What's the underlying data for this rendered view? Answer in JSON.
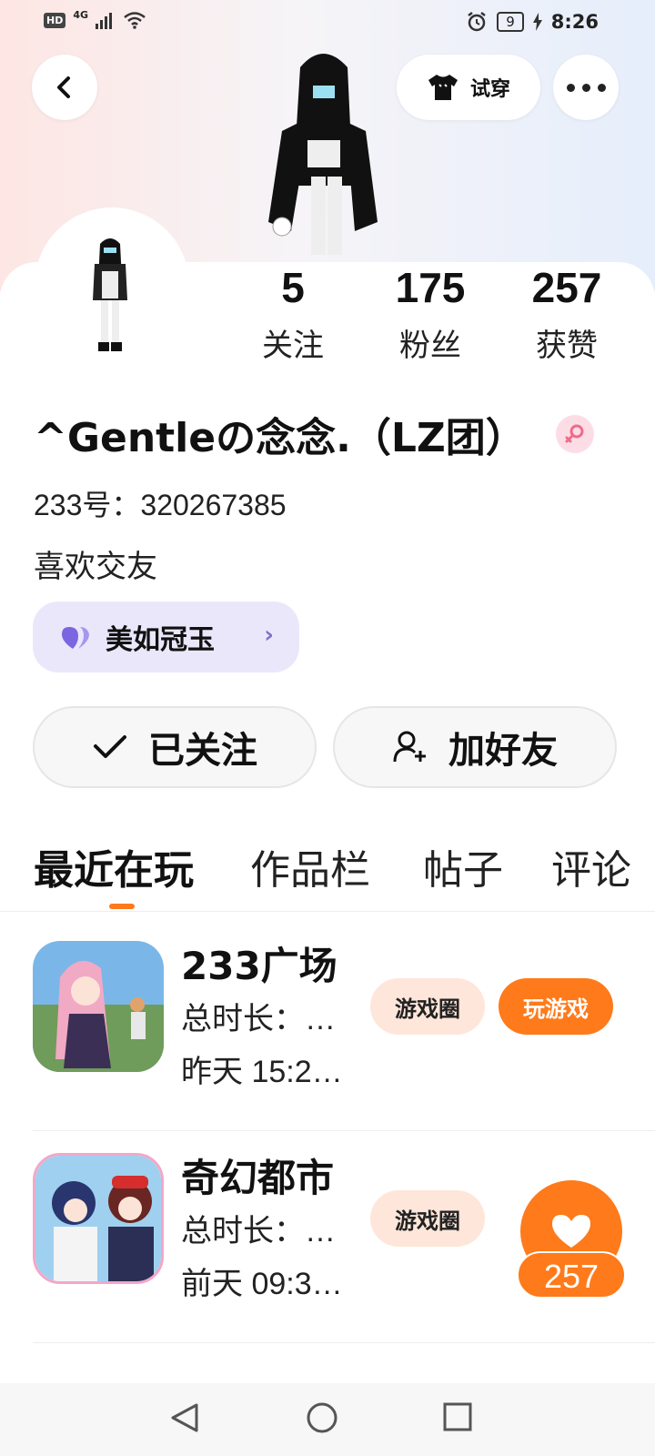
{
  "status_bar": {
    "hd_label": "HD",
    "network": "4G",
    "battery_level": "9",
    "time": "8:26"
  },
  "header": {
    "try_on_label": "试穿"
  },
  "stats": [
    {
      "value": "5",
      "label": "关注"
    },
    {
      "value": "175",
      "label": "粉丝"
    },
    {
      "value": "257",
      "label": "获赞"
    }
  ],
  "profile": {
    "name": "^Gentleの念念.（LZ团）",
    "account_id": "233号：320267385",
    "bio": "喜欢交友",
    "tag_label": "美如冠玉",
    "tag_chevron": "›"
  },
  "actions": {
    "follow_label": "已关注",
    "add_friend_label": "加好友"
  },
  "tabs": [
    "最近在玩",
    "作品栏",
    "帖子",
    "评论"
  ],
  "games": [
    {
      "title": "233广场",
      "duration": "总时长：…",
      "last_played": "昨天 15:2…",
      "circle_label": "游戏圈",
      "play_label": "玩游戏"
    },
    {
      "title": "奇幻都市",
      "duration": "总时长：…",
      "last_played": "前天 09:3…",
      "circle_label": "游戏圈"
    }
  ],
  "like_fab": {
    "count": "257"
  },
  "colors": {
    "accent": "#ff7a1a",
    "chip_bg": "#ffe6da",
    "tag_bg": "#ebe7fb"
  }
}
